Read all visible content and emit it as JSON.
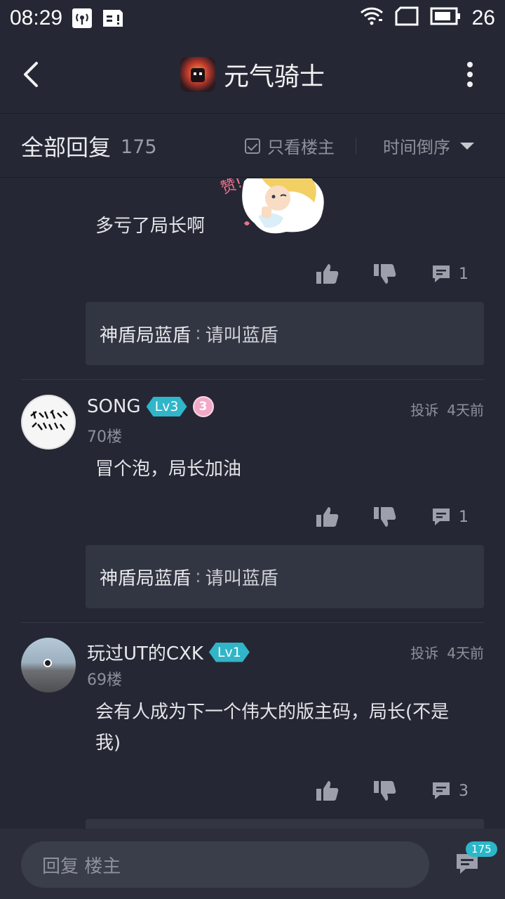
{
  "status_bar": {
    "time": "08:29",
    "battery": "26",
    "icons": [
      "hotspot-icon",
      "sim-icon",
      "wifi-icon",
      "screen-rotate-icon",
      "battery-icon"
    ]
  },
  "header": {
    "title": "元气骑士",
    "back_icon": "back-arrow-icon",
    "more_icon": "more-vertical-icon"
  },
  "subheader": {
    "all_replies_label": "全部回复",
    "all_replies_count": "175",
    "owner_only_label": "只看楼主",
    "sort_label": "时间倒序"
  },
  "posts": [
    {
      "text": "多亏了局长啊",
      "sticker_text": "赞!",
      "comment_count": "1",
      "reply": {
        "name": "神盾局蓝盾",
        "sep": ":",
        "text": "请叫蓝盾"
      }
    },
    {
      "username": "SONG",
      "level": "Lv3",
      "medal": "3",
      "floor": "70楼",
      "report": "投诉",
      "time_ago": "4天前",
      "text": "冒个泡，局长加油",
      "comment_count": "1",
      "reply": {
        "name": "神盾局蓝盾",
        "sep": ":",
        "text": "请叫蓝盾"
      }
    },
    {
      "username": "玩过UT的CXK",
      "level": "Lv1",
      "floor": "69楼",
      "report": "投诉",
      "time_ago": "4天前",
      "text_line1": "会有人成为下一个伟大的版主码，局长(不是",
      "text_line2": "我)",
      "comment_count": "3"
    }
  ],
  "bottom_bar": {
    "input_placeholder": "回复  楼主",
    "comment_badge": "175"
  },
  "colors": {
    "background": "#252834",
    "card": "#323542",
    "accent": "#31b5c8",
    "muted_text": "#8e909a"
  }
}
